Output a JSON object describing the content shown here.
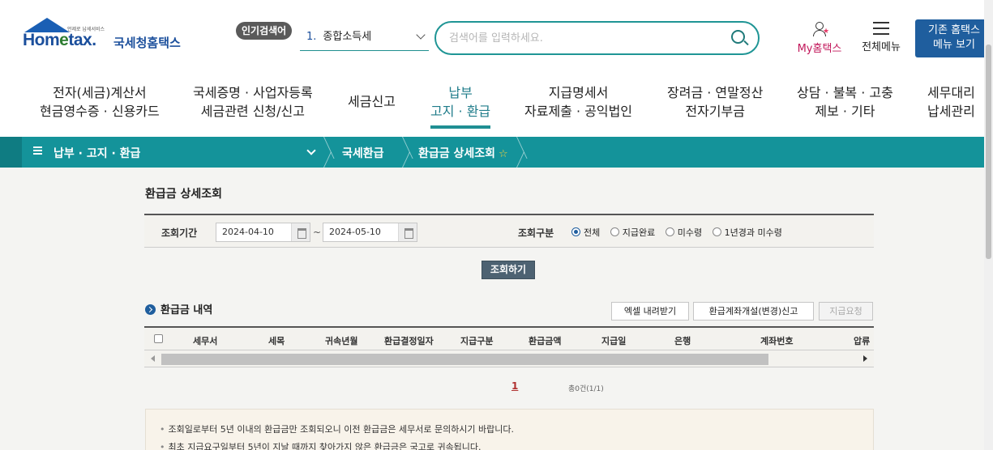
{
  "header": {
    "logo_tagline": "언제로 납세서비스",
    "logo_brand_pre": "Hom",
    "logo_brand_e": "e",
    "logo_brand_post": "tax.",
    "logo_korean": "국세청홈택스",
    "popular_label": "인기검색어",
    "popular_rank": "1.",
    "popular_keyword": "종합소득세",
    "search_placeholder": "검색어를 입력하세요.",
    "my_home": "My홈택스",
    "all_menu": "전체메뉴",
    "old_menu_line1": "기존 홈택스",
    "old_menu_line2": "메뉴 보기"
  },
  "gnb": [
    {
      "line1": "전자(세금)계산서",
      "line2": "현금영수증 · 신용카드"
    },
    {
      "line1": "국세증명 · 사업자등록",
      "line2": "세금관련 신청/신고"
    },
    {
      "line1": "세금신고",
      "line2": ""
    },
    {
      "line1": "납부",
      "line2": "고지 · 환급"
    },
    {
      "line1": "지급명세서",
      "line2": "자료제출 · 공익법인"
    },
    {
      "line1": "장려금 · 연말정산",
      "line2": "전자기부금"
    },
    {
      "line1": "상담 · 불복 · 고충",
      "line2": "제보 · 기타"
    },
    {
      "line1": "세무대리",
      "line2": "납세관리"
    }
  ],
  "breadcrumb": {
    "menu": "납부 · 고지 · 환급",
    "level2": "국세환급",
    "level3": "환급금 상세조회",
    "fav_glyph": "☆"
  },
  "page": {
    "title": "환급금 상세조회",
    "period_label": "조회기간",
    "date_from": "2024-04-10",
    "date_to": "2024-05-10",
    "tilde": "~",
    "type_label": "조회구분",
    "radio_options": [
      "전체",
      "지급완료",
      "미수령",
      "1년경과 미수령"
    ],
    "search_button": "조회하기",
    "list_title": "환급금 내역",
    "btn_excel": "엑셀 내려받기",
    "btn_account": "환급계좌개설(변경)신고",
    "btn_request": "지급요청",
    "columns": [
      "세무서",
      "세목",
      "귀속년월",
      "환급결정일자",
      "지급구분",
      "환급금액",
      "지급일",
      "은행",
      "계좌번호",
      "압류"
    ],
    "page_current": "1",
    "total_text": "총0건(1/1)",
    "notices": [
      "조회일로부터 5년 이내의 환급금만 조회되오니 이전 환급금은 세무서로 문의하시기 바랍니다.",
      "최초 지급요구일부터 5년이 지날 때까지 찾아가지 않은 환급금은 국고로 귀속됩니다."
    ]
  },
  "colors": {
    "teal": "#14939a",
    "navy": "#1f5e9e",
    "accent_pink": "#c2185b"
  }
}
